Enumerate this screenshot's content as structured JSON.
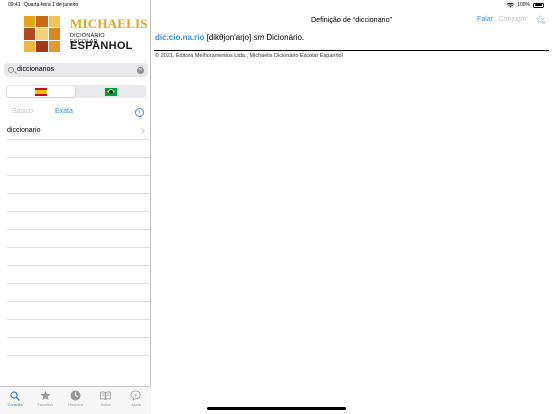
{
  "status_bar": {
    "time": "09:41",
    "date": "Quarta-feira 1 de janeiro",
    "battery": "100%"
  },
  "logo": {
    "brand": "MICHAELIS",
    "subtitle": "DICIONÁRIO ESCOLAR",
    "product": "ESPANHOL"
  },
  "search": {
    "value": "diccionarios",
    "icon": "search-icon",
    "clear_icon": "clear-icon"
  },
  "language_toggle": {
    "options": [
      "flag-spain",
      "flag-brazil"
    ],
    "selected": "flag-spain"
  },
  "search_mode": {
    "basic_label": "Básico",
    "exact_label": "Exata",
    "selected": "Exata",
    "info_glyph": "i"
  },
  "results": [
    {
      "label": "diccionario"
    }
  ],
  "tabbar": {
    "tabs": [
      {
        "label": "Consulta",
        "icon": "search-icon",
        "active": true
      },
      {
        "label": "Favoritos",
        "icon": "star-icon",
        "active": false
      },
      {
        "label": "Histórico",
        "icon": "clock-icon",
        "active": false
      },
      {
        "label": "Índice",
        "icon": "book-icon",
        "active": false
      },
      {
        "label": "Ajuda",
        "icon": "help-icon",
        "active": false
      }
    ]
  },
  "detail": {
    "title": "Definição de “diccionario”",
    "speak_label": "Falar",
    "conjugate_label": "Conjugar",
    "favorite_icon": "star-plus-icon",
    "entry_headword": "dic.cio.na.rio",
    "entry_pron": " [dikθjon'arjo] ",
    "entry_gram": "sm",
    "entry_def": " Dicionário.",
    "copyright": "© 2021, Editora Melhoramentos Ltda., Michaelis Dicionário Escolar Espanhol"
  },
  "colors": {
    "accent": "#3b8ee6",
    "brand": "#e8a21c",
    "inactive": "#c7c7cc"
  }
}
